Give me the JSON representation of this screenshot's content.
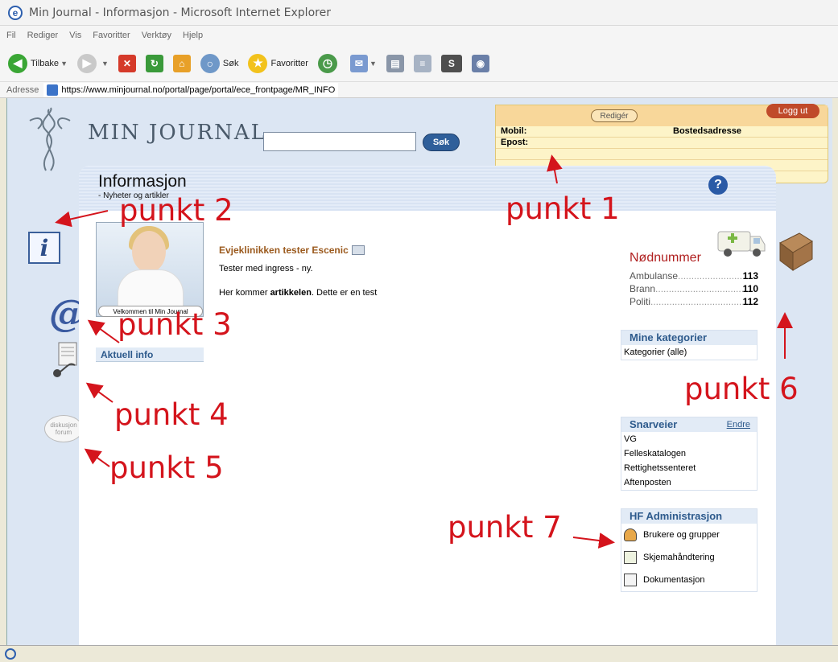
{
  "window": {
    "title": "Min Journal - Informasjon - Microsoft Internet Explorer"
  },
  "menu": [
    "Fil",
    "Rediger",
    "Vis",
    "Favoritter",
    "Verktøy",
    "Hjelp"
  ],
  "toolbar": {
    "back_label": "Tilbake",
    "search_label": "Søk",
    "favorites_label": "Favoritter"
  },
  "address": {
    "label": "Adresse",
    "url": "https://www.minjournal.no/portal/page/portal/ece_frontpage/MR_INFO"
  },
  "site": {
    "logo_text": "MIN JOURNAL",
    "search_button": "Søk"
  },
  "user_panel": {
    "edit_label": "Redigér",
    "logout_label": "Logg ut",
    "mobile_label": "Mobil:",
    "email_label": "Epost:",
    "address_label": "Bostedsadresse"
  },
  "content": {
    "title": "Informasjon",
    "subtitle": "- Nyheter og artikler",
    "photo_caption": "Velkommen til Min Journal",
    "aktuell": "Aktuell info",
    "article": {
      "title": "Evjeklinikken tester Escenic",
      "ingress": "Tester med ingress - ny.",
      "body_prefix": "Her kommer ",
      "body_bold": "artikkelen",
      "body_suffix": ". Dette er en test"
    }
  },
  "forum_icon_text": "diskusjon forum",
  "emergency": {
    "title": "Nødnummer",
    "rows": [
      {
        "label": "Ambulanse",
        "number": "113"
      },
      {
        "label": "Brann",
        "number": "110"
      },
      {
        "label": "Politi",
        "number": "112"
      }
    ]
  },
  "categories": {
    "title": "Mine kategorier",
    "items": [
      "Kategorier (alle)"
    ]
  },
  "shortcuts": {
    "title": "Snarveier",
    "edit_label": "Endre",
    "items": [
      "VG",
      "Felleskatalogen",
      "Rettighetssenteret",
      "Aftenposten"
    ]
  },
  "admin": {
    "title": "HF Administrasjon",
    "items": [
      "Brukere og grupper",
      "Skjemahåndtering",
      "Dokumentasjon"
    ]
  },
  "annotations": [
    "punkt 1",
    "punkt 2",
    "punkt 3",
    "punkt 4",
    "punkt 5",
    "punkt 6",
    "punkt 7"
  ],
  "colors": {
    "annotation": "#d4141c",
    "panel_heading": "#2d5a8c",
    "emergency_title": "#b02020",
    "article_title": "#9b5a1e"
  }
}
